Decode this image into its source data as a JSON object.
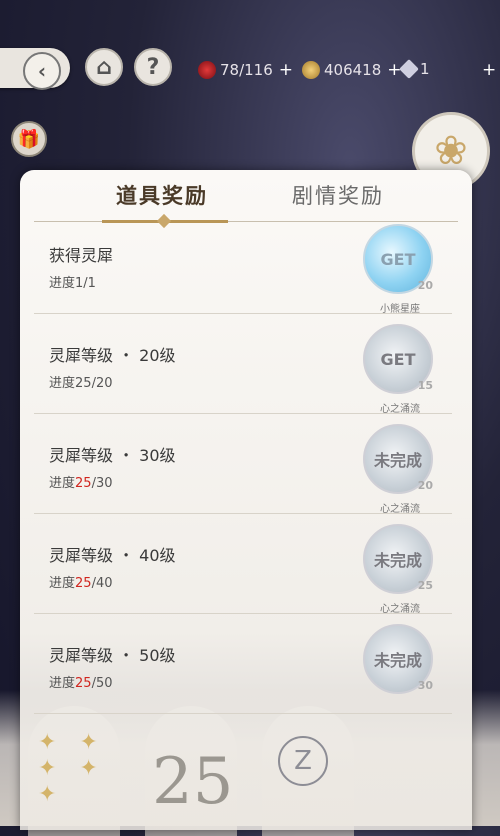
{
  "resources": {
    "stamina": "78/116",
    "coins": "406418",
    "diamonds": "1",
    "plus": "+"
  },
  "icons": {
    "back": "‹",
    "home": "⌂",
    "help": "?",
    "gift": "🎁",
    "crest": "❀"
  },
  "tabs": {
    "active": "道具奖励",
    "inactive": "剧情奖励"
  },
  "rows": [
    {
      "title": "获得灵犀",
      "progress_prefix": "进度",
      "progress_current": "1",
      "progress_total": "/1",
      "status": "GET",
      "qty": "20",
      "reward_name": "小熊星座"
    },
    {
      "title": "灵犀等级 ・ 20级",
      "progress_prefix": "进度",
      "progress_current": "25",
      "progress_total": "/20",
      "status": "GET",
      "qty": "15",
      "reward_name": "心之涌流"
    },
    {
      "title": "灵犀等级 ・ 30级",
      "progress_prefix": "进度",
      "progress_current": "25",
      "progress_total": "/30",
      "status": "未完成",
      "qty": "20",
      "reward_name": "心之涌流"
    },
    {
      "title": "灵犀等级 ・ 40级",
      "progress_prefix": "进度",
      "progress_current": "25",
      "progress_total": "/40",
      "status": "未完成",
      "qty": "25",
      "reward_name": "心之涌流"
    },
    {
      "title": "灵犀等级 ・ 50级",
      "progress_prefix": "进度",
      "progress_current": "25",
      "progress_total": "/50",
      "status": "未完成",
      "qty": "30",
      "reward_name": ""
    }
  ],
  "bottom": {
    "level": "25"
  },
  "colors": {
    "accent_gold": "#b99656",
    "progress_red": "#d1261f"
  }
}
